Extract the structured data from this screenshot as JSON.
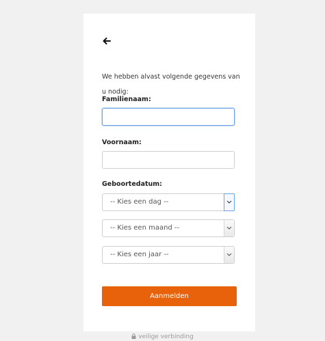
{
  "form": {
    "intro": "We hebben alvast volgende gegevens van u nodig:",
    "last_name_label": "Familienaam:",
    "last_name_value": "",
    "first_name_label": "Voornaam:",
    "first_name_value": "",
    "birthdate_label": "Geboortedatum:",
    "day_select": "-- Kies een dag --",
    "month_select": "-- Kies een maand --",
    "year_select": "-- Kies een jaar --",
    "submit_label": "Aanmelden"
  },
  "footer": {
    "secure_text": "veilige verbinding"
  },
  "icons": {
    "back": "arrow-left-icon",
    "dropdown": "chevron-down-icon",
    "secure": "lock-icon"
  },
  "colors": {
    "accent": "#e8620c",
    "focus": "#6aa3e8",
    "background": "#f1f1f1"
  }
}
